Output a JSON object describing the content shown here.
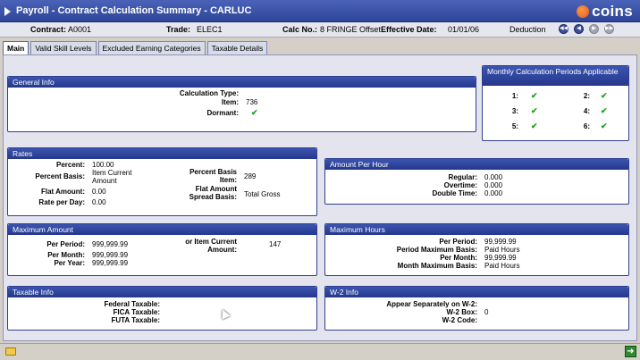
{
  "window": {
    "title": "Payroll - Contract Calculation Summary - CARLUC",
    "logo": "coins"
  },
  "infobar": {
    "contract_label": "Contract:",
    "contract_value": "A0001",
    "trade_label": "Trade:",
    "trade_value": "ELEC1",
    "calc_label": "Calc No.:",
    "calc_value": "8 FRINGE Offset",
    "effective_label": "Effective Date:",
    "effective_value": "01/01/06",
    "deduction": "Deduction",
    "nav_icons": [
      "first-icon",
      "previous-icon",
      "next-icon",
      "last-icon"
    ]
  },
  "tabs": [
    "Main",
    "Valid Skill Levels",
    "Excluded Earning Categories",
    "Taxable Details"
  ],
  "general_info": {
    "header": "General Info",
    "calc_type_label": "Calculation Type:",
    "calc_type_value": "",
    "item_label": "Item:",
    "item_value": "736",
    "dormant_label": "Dormant:",
    "dormant_checked": true
  },
  "monthly": {
    "header": "Monthly Calculation Periods Applicable",
    "periods": [
      {
        "label": "1:",
        "checked": true
      },
      {
        "label": "2:",
        "checked": true
      },
      {
        "label": "3:",
        "checked": true
      },
      {
        "label": "4:",
        "checked": true
      },
      {
        "label": "5:",
        "checked": true
      },
      {
        "label": "6:",
        "checked": true
      }
    ]
  },
  "rates": {
    "header": "Rates",
    "percent_label": "Percent:",
    "percent_value": "100.00",
    "percent_basis_label": "Percent Basis:",
    "percent_basis_value_1": "Item Current",
    "percent_basis_value_2": "Amount",
    "flat_amount_label": "Flat Amount:",
    "flat_amount_value": "0.00",
    "rate_per_day_label": "Rate per Day:",
    "rate_per_day_value": "0.00",
    "pb_item_label_1": "Percent Basis",
    "pb_item_label_2": "Item:",
    "pb_item_value": "289",
    "fa_spread_label_1": "Flat Amount",
    "fa_spread_label_2": "Spread Basis:",
    "fa_spread_value": "Total Gross"
  },
  "amount_per_hour": {
    "header": "Amount Per Hour",
    "regular_label": "Regular:",
    "regular_value": "0.000",
    "overtime_label": "Overtime:",
    "overtime_value": "0.000",
    "double_label": "Double Time:",
    "double_value": "0.000"
  },
  "max_amount": {
    "header": "Maximum Amount",
    "per_period_label": "Per Period:",
    "per_period_value": "999,999.99",
    "per_month_label": "Per Month:",
    "per_month_value": "999,999.99",
    "per_year_label": "Per Year:",
    "per_year_value": "999,999.99",
    "item_current_label_1": "or Item Current",
    "item_current_label_2": "Amount:",
    "item_current_value": "147"
  },
  "max_hours": {
    "header": "Maximum Hours",
    "per_period_label": "Per Period:",
    "per_period_value": "99,999.99",
    "period_basis_label": "Period Maximum Basis:",
    "period_basis_value": "Paid Hours",
    "per_month_label": "Per Month:",
    "per_month_value": "99,999.99",
    "month_basis_label": "Month Maximum Basis:",
    "month_basis_value": "Paid Hours"
  },
  "taxable_info": {
    "header": "Taxable Info",
    "federal_label": "Federal Taxable:",
    "fica_label": "FICA Taxable:",
    "futa_label": "FUTA Taxable:"
  },
  "w2_info": {
    "header": "W-2 Info",
    "appear_label": "Appear Separately on W-2:",
    "box_label": "W-2 Box:",
    "box_value": "0",
    "code_label": "W-2 Code:"
  }
}
